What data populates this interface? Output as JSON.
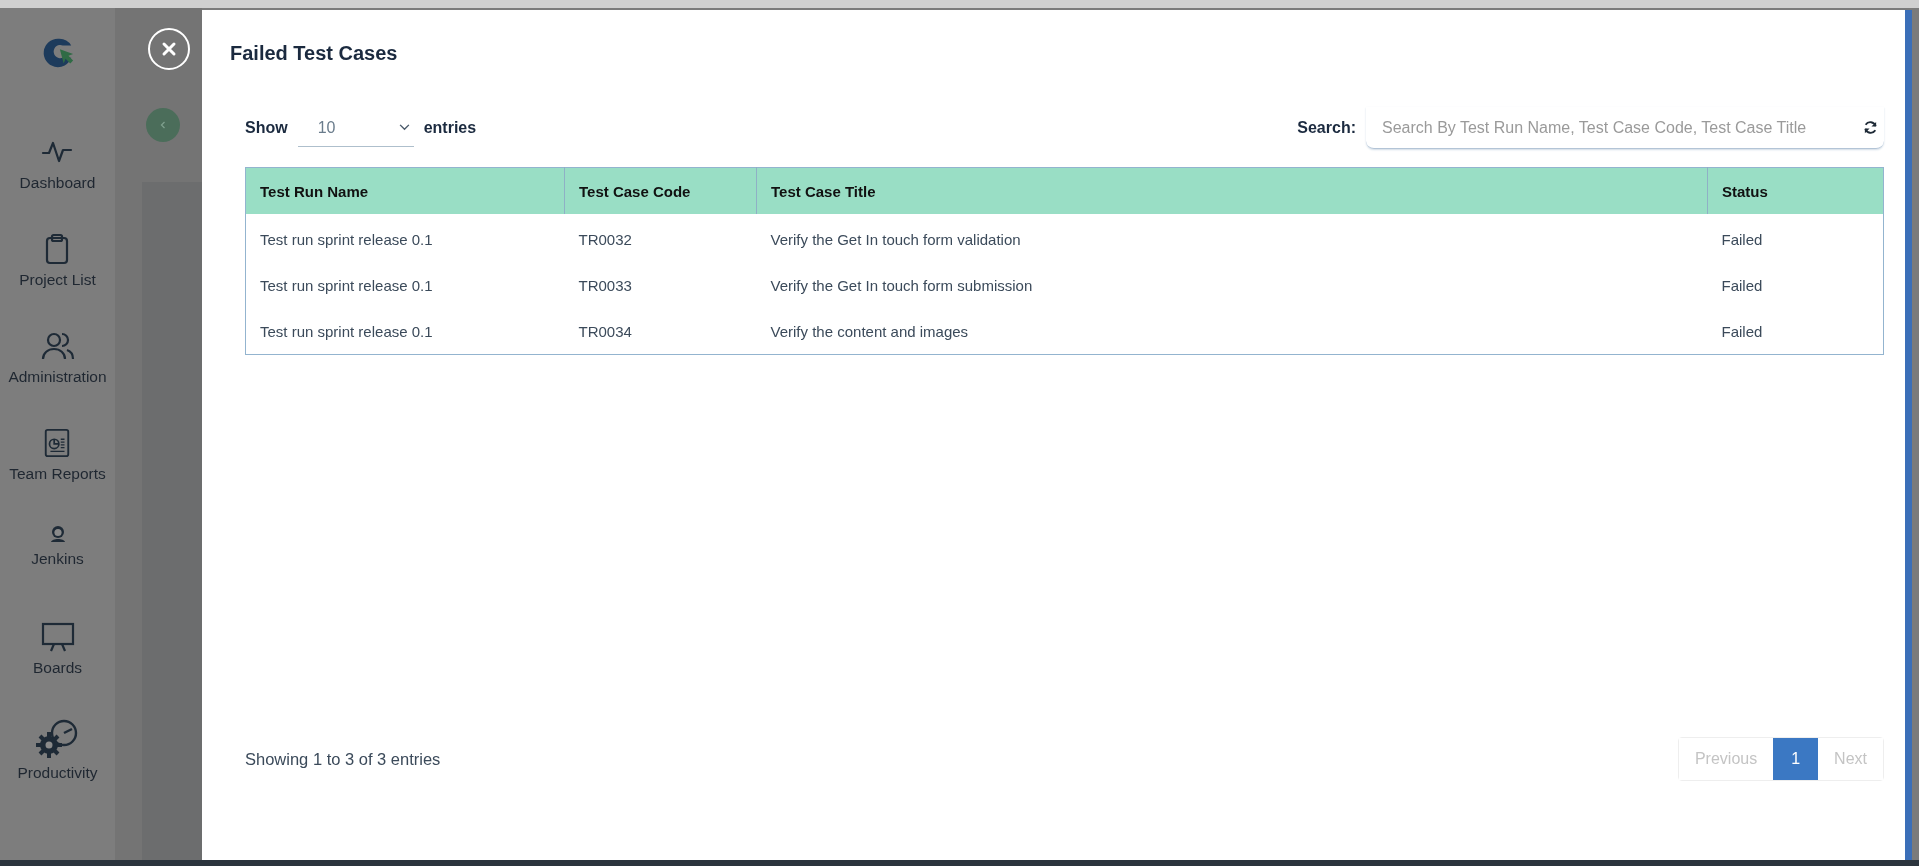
{
  "sidebar": {
    "items": [
      {
        "label": "Dashboard"
      },
      {
        "label": "Project List"
      },
      {
        "label": "Administration"
      },
      {
        "label": "Team Reports"
      },
      {
        "label": "Jenkins"
      },
      {
        "label": "Boards"
      },
      {
        "label": "Productivity"
      }
    ]
  },
  "modal": {
    "title": "Failed Test Cases",
    "length": {
      "label_before": "Show",
      "value": "10",
      "label_after": "entries"
    },
    "search": {
      "label": "Search:",
      "placeholder": "Search By Test Run Name, Test Case Code, Test Case Title"
    },
    "table": {
      "columns": [
        "Test Run Name",
        "Test Case Code",
        "Test Case Title",
        "Status"
      ],
      "rows": [
        [
          "Test run sprint release 0.1",
          "TR0032",
          "Verify the Get In touch form validation",
          "Failed"
        ],
        [
          "Test run sprint release 0.1",
          "TR0033",
          "Verify the Get In touch form submission",
          "Failed"
        ],
        [
          "Test run sprint release 0.1",
          "TR0034",
          "Verify the content and images",
          "Failed"
        ]
      ]
    },
    "info": "Showing 1 to 3 of 3 entries",
    "pagination": [
      {
        "label": "Previous",
        "selected": false,
        "disabled": true
      },
      {
        "label": "1",
        "selected": true,
        "disabled": false
      },
      {
        "label": "Next",
        "selected": false,
        "disabled": true
      }
    ]
  }
}
